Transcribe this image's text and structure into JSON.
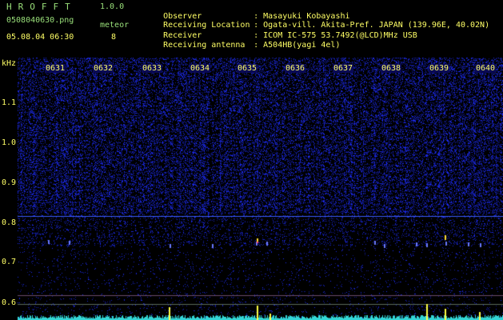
{
  "app": {
    "name": "HROFFT",
    "version": "1.0.0"
  },
  "file": {
    "name": "0508040630.png",
    "datetime": "05.08.04 06:30"
  },
  "meteor": {
    "label": "meteor",
    "count": "8"
  },
  "info": [
    {
      "label": "Observer",
      "value": ": Masayuki Kobayashi"
    },
    {
      "label": "Receiving Location",
      "value": ": Ogata-vill. Akita-Pref. JAPAN (139.96E, 40.02N)"
    },
    {
      "label": "Receiver",
      "value": ": ICOM IC-575 53.7492(@LCD)MHz USB"
    },
    {
      "label": "Receiving antenna",
      "value": ": A504HB(yagi 4el)"
    }
  ],
  "axis": {
    "unit": "kHz",
    "freq_ticks": [
      "1.1",
      "1.0",
      "0.9",
      "0.8",
      "0.7",
      "0.6"
    ],
    "time_ticks": [
      "0631",
      "0632",
      "0633",
      "0634",
      "0635",
      "0636",
      "0637",
      "0638",
      "0639",
      "0640"
    ]
  },
  "colors": {
    "label": "#ffff66",
    "title": "#9ae07a",
    "noise": "#2030c0",
    "trace": "#3b5bff"
  }
}
